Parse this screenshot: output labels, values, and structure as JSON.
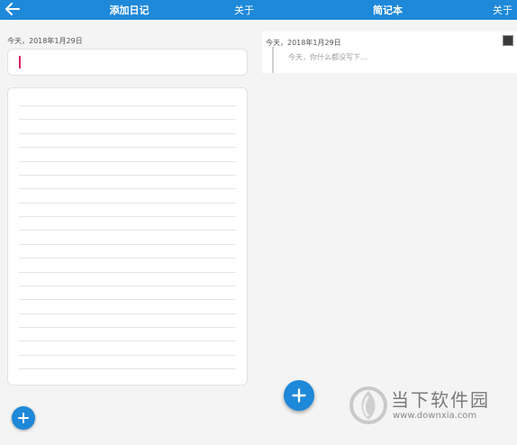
{
  "left_screen": {
    "appbar": {
      "back_icon": "arrow-left-icon",
      "title": "添加日记",
      "about_label": "关于"
    },
    "date_label": "今天，2018年1月29日",
    "title_input": {
      "value": ""
    },
    "body_input": {
      "value": ""
    },
    "fab_icon": "plus-icon"
  },
  "right_screen": {
    "appbar": {
      "title": "简记本",
      "about_label": "关于"
    },
    "notes": [
      {
        "date": "今天，2018年1月29日",
        "preview": "今天，你什么都没写下..."
      }
    ],
    "fab_icon": "plus-icon"
  },
  "watermark": {
    "brand": "当下软件园",
    "url": "www.downxia.com"
  },
  "colors": {
    "primary": "#1e88d9",
    "background": "#f4f4f4",
    "caret": "#e0245e"
  }
}
